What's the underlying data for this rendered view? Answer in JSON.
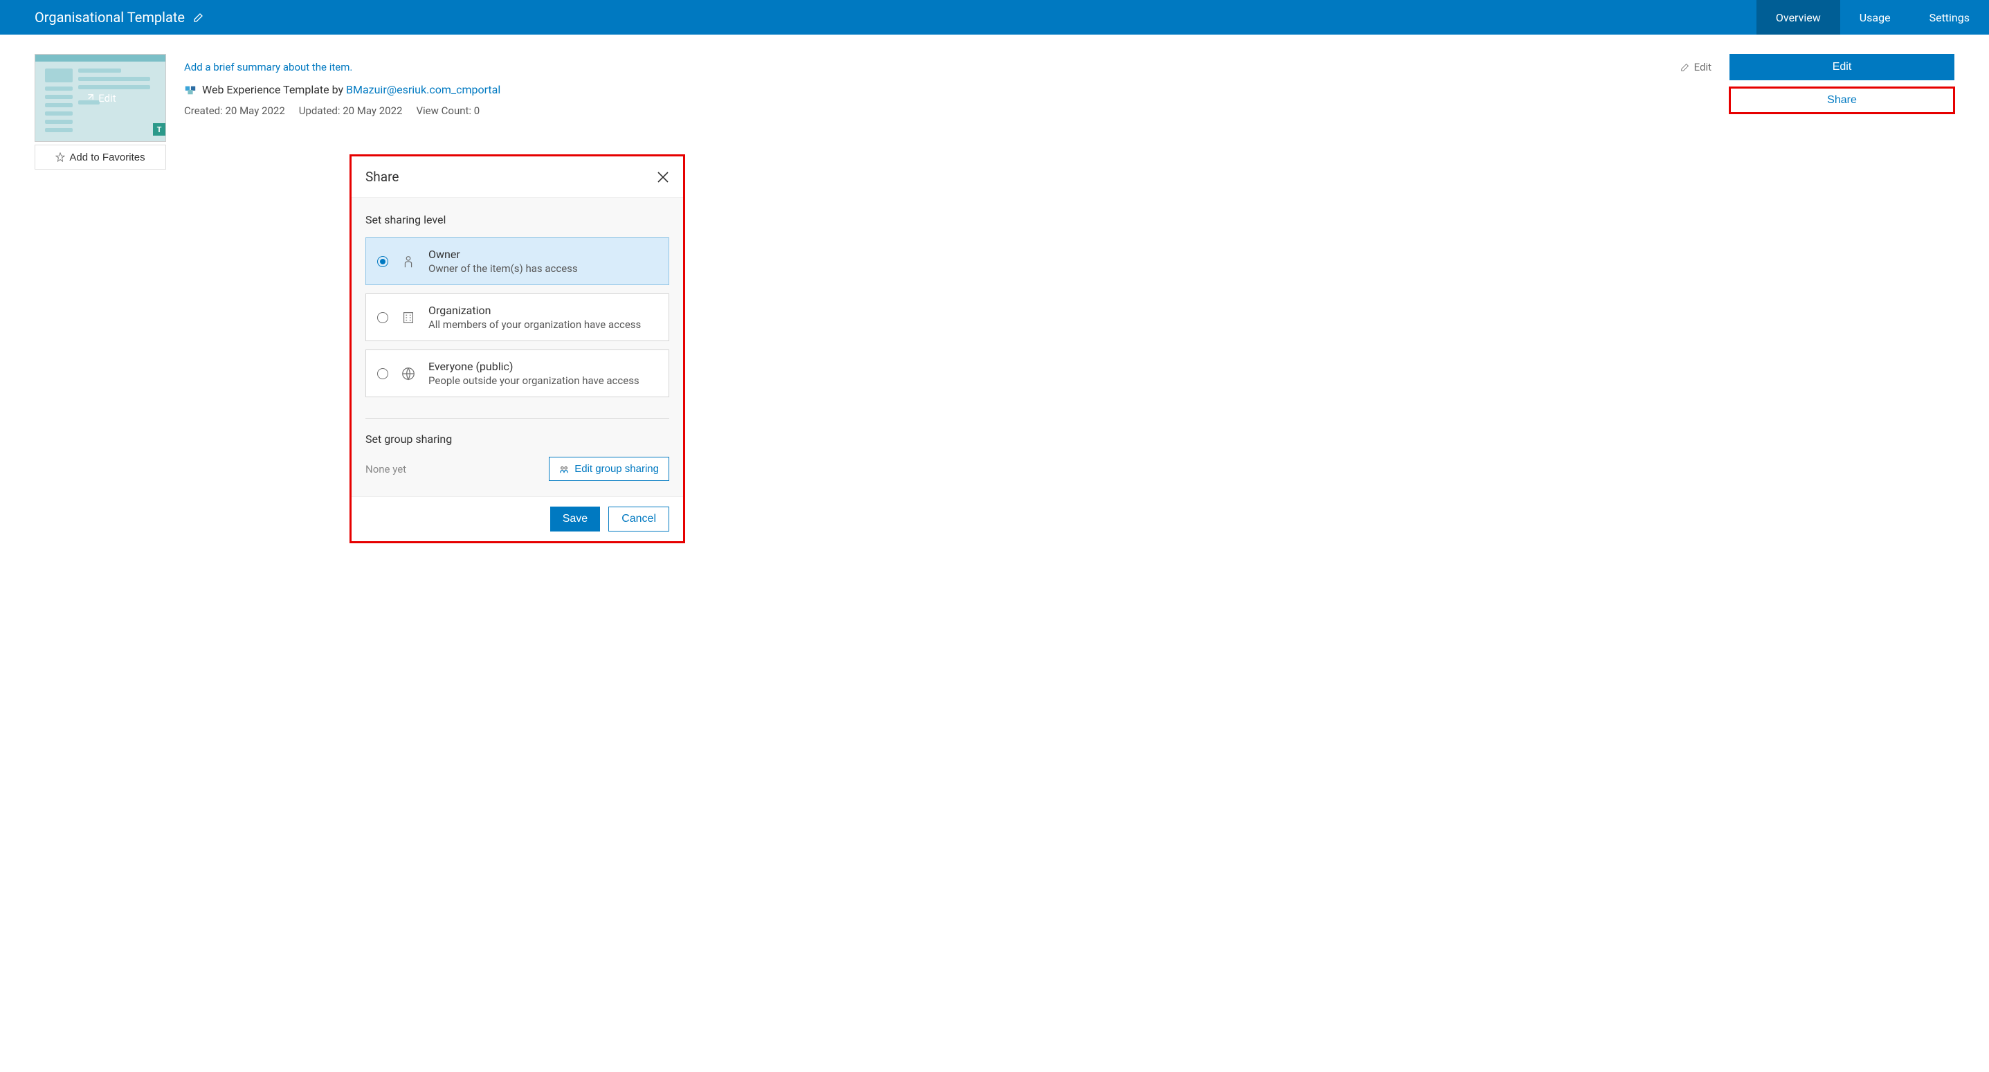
{
  "header": {
    "title": "Organisational Template",
    "tabs": [
      {
        "label": "Overview",
        "active": true
      },
      {
        "label": "Usage",
        "active": false
      },
      {
        "label": "Settings",
        "active": false
      }
    ]
  },
  "thumb": {
    "overlay_label": "Edit",
    "badge": "T"
  },
  "favorites_label": "Add to Favorites",
  "summary": {
    "placeholder": "Add a brief summary about the item.",
    "edit_label": "Edit"
  },
  "type_row": {
    "type_text": "Web Experience Template by ",
    "author": "BMazuir@esriuk.com_cmportal"
  },
  "meta": {
    "created": "Created: 20 May 2022",
    "updated": "Updated: 20 May 2022",
    "views": "View Count: 0"
  },
  "side": {
    "edit": "Edit",
    "share": "Share"
  },
  "modal": {
    "title": "Share",
    "section_level": "Set sharing level",
    "options": [
      {
        "key": "owner",
        "title": "Owner",
        "desc": "Owner of the item(s) has access",
        "selected": true
      },
      {
        "key": "org",
        "title": "Organization",
        "desc": "All members of your organization have access",
        "selected": false
      },
      {
        "key": "public",
        "title": "Everyone (public)",
        "desc": "People outside your organization have access",
        "selected": false
      }
    ],
    "section_group": "Set group sharing",
    "none_yet": "None yet",
    "edit_group": "Edit group sharing",
    "save": "Save",
    "cancel": "Cancel"
  }
}
